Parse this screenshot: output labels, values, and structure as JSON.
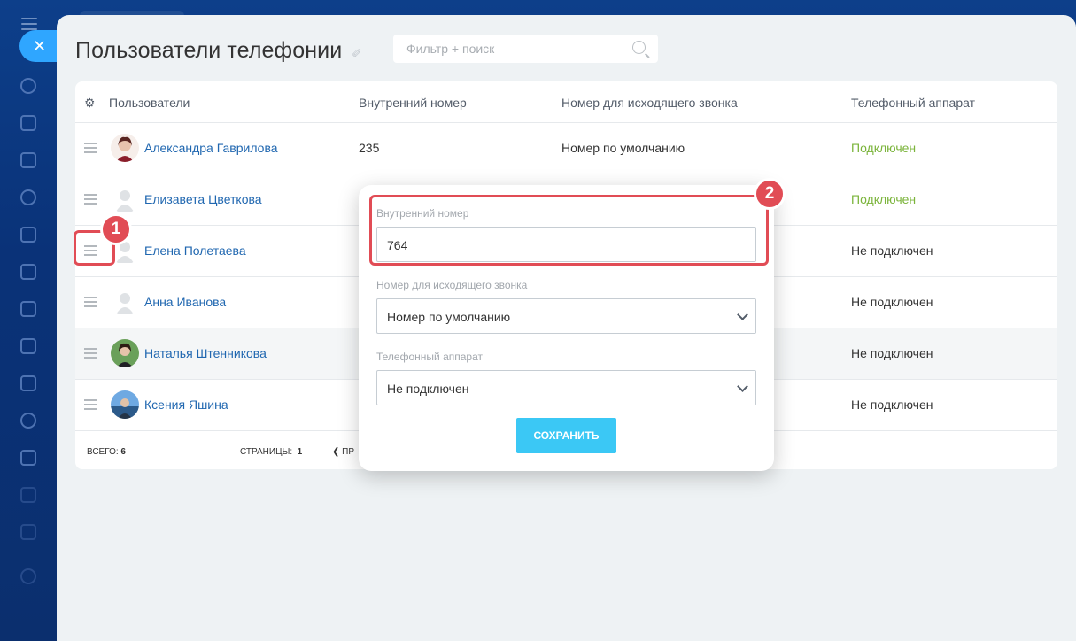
{
  "page": {
    "title": "Пользователи телефонии",
    "search_placeholder": "Фильтр + поиск"
  },
  "columns": [
    "Пользователи",
    "Внутренний номер",
    "Номер для исходящего звонка",
    "Телефонный аппарат"
  ],
  "rows": [
    {
      "name": "Александра Гаврилова",
      "number": "235",
      "outgoing": "Номер по умолчанию",
      "device": "Подключен",
      "device_status": "connected"
    },
    {
      "name": "Елизавета Цветкова",
      "number": "",
      "outgoing": "",
      "device": "Подключен",
      "device_status": "connected"
    },
    {
      "name": "Елена Полетаева",
      "number": "",
      "outgoing": "",
      "device": "Не подключен",
      "device_status": "disconnected"
    },
    {
      "name": "Анна Иванова",
      "number": "",
      "outgoing": "",
      "device": "Не подключен",
      "device_status": "disconnected"
    },
    {
      "name": "Наталья Штенникова",
      "number": "",
      "outgoing": "",
      "device": "Не подключен",
      "device_status": "disconnected"
    },
    {
      "name": "Ксения Яшина",
      "number": "",
      "outgoing": "",
      "device": "Не подключен",
      "device_status": "disconnected"
    }
  ],
  "footer": {
    "total_label": "ВСЕГО:",
    "total_value": "6",
    "pages_label": "СТРАНИЦЫ:",
    "pages_value": "1",
    "prev_label": "ПР"
  },
  "popup": {
    "internal_label": "Внутренний номер",
    "internal_value": "764",
    "outgoing_label": "Номер для исходящего звонка",
    "outgoing_value": "Номер по умолчанию",
    "device_label": "Телефонный аппарат",
    "device_value": "Не подключен",
    "save_label": "СОХРАНИТЬ"
  },
  "callouts": {
    "one": "1",
    "two": "2"
  },
  "colors": {
    "accent": "#3bc8f5",
    "link": "#2067b0",
    "connected": "#7bb43b",
    "callout": "#e14c55"
  }
}
